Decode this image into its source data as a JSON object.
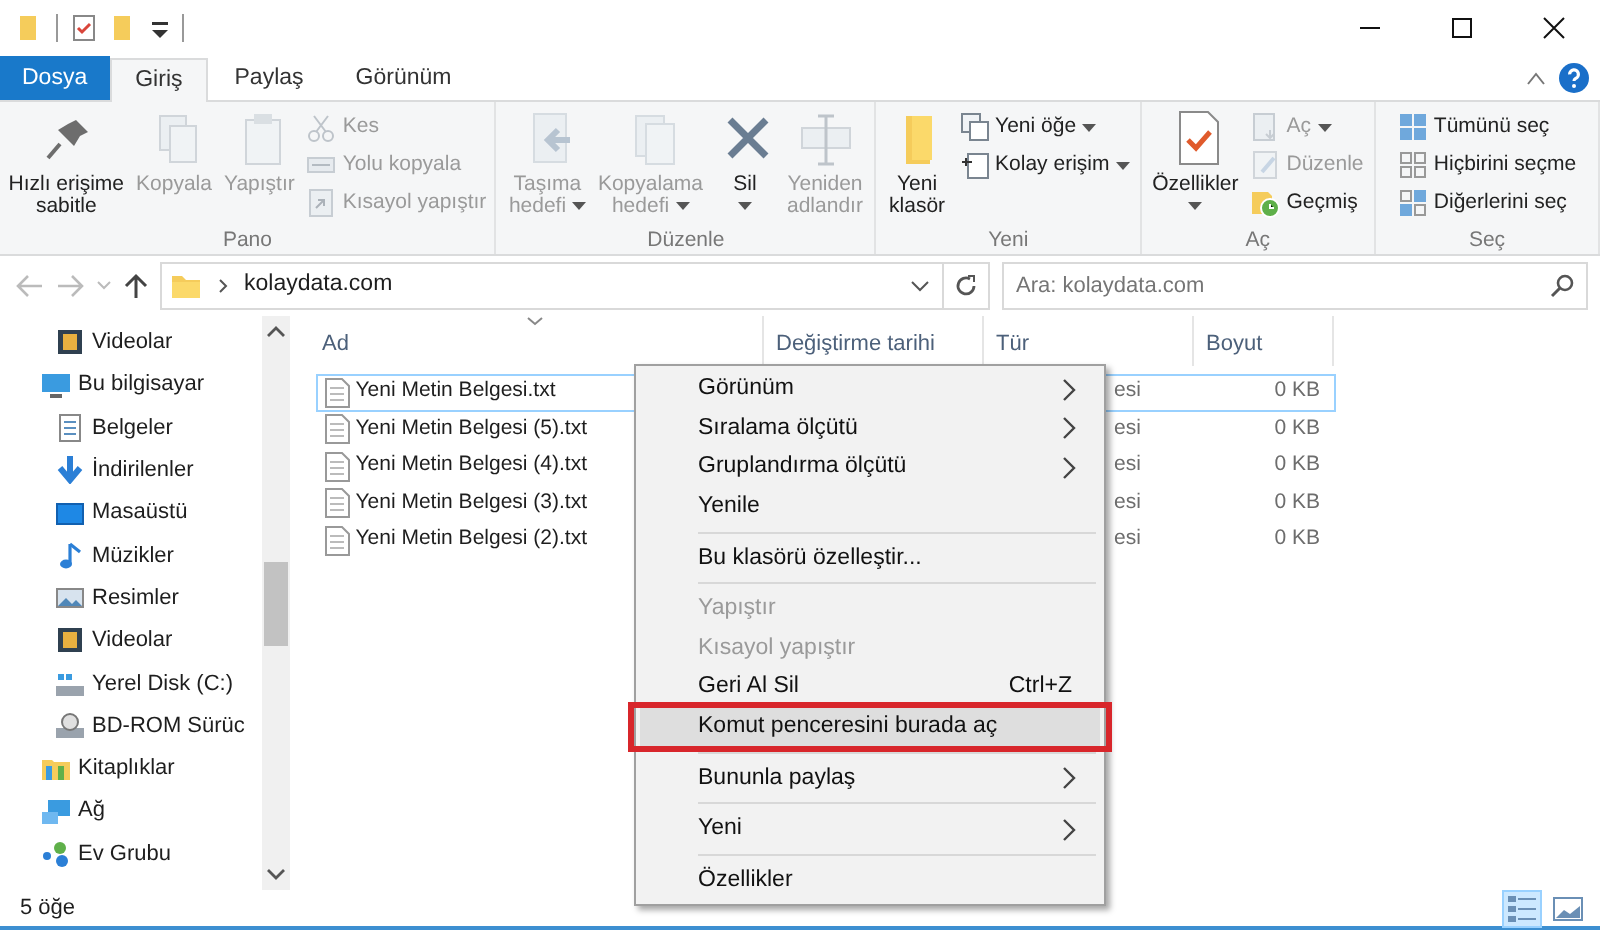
{
  "ribbon": {
    "tabs": [
      {
        "label": "Dosya",
        "kind": "file",
        "selected": false
      },
      {
        "label": "Giriş",
        "kind": "tab",
        "selected": true
      },
      {
        "label": "Paylaş",
        "kind": "tab",
        "selected": false
      },
      {
        "label": "Görünüm",
        "kind": "tab",
        "selected": false
      }
    ],
    "groups": [
      {
        "label": "Pano",
        "commands": [
          {
            "kind": "large",
            "lines": [
              "Hızlı erişime",
              "sabitle"
            ],
            "disabled": false
          },
          {
            "kind": "large",
            "lines": [
              "Kopyala"
            ],
            "disabled": true
          },
          {
            "kind": "large",
            "lines": [
              "Yapıştır"
            ],
            "disabled": true
          },
          {
            "kind": "small",
            "lines": [
              "Kes"
            ],
            "disabled": true
          },
          {
            "kind": "small",
            "lines": [
              "Yolu kopyala"
            ],
            "disabled": true
          },
          {
            "kind": "small",
            "lines": [
              "Kısayol yapıştır"
            ],
            "disabled": true
          }
        ]
      },
      {
        "label": "Düzenle",
        "commands": [
          {
            "kind": "large",
            "lines": [
              "Taşıma",
              "hedefi"
            ],
            "disabled": true,
            "dropdown": true
          },
          {
            "kind": "large",
            "lines": [
              "Kopyalama",
              "hedefi"
            ],
            "disabled": true,
            "dropdown": true
          },
          {
            "kind": "large",
            "lines": [
              "Sil"
            ],
            "disabled": false,
            "dropdown": true
          },
          {
            "kind": "large",
            "lines": [
              "Yeniden",
              "adlandır"
            ],
            "disabled": true
          }
        ]
      },
      {
        "label": "Yeni",
        "commands": [
          {
            "kind": "large",
            "lines": [
              "Yeni",
              "klasör"
            ],
            "disabled": false
          },
          {
            "kind": "small",
            "lines": [
              "Yeni öğe"
            ],
            "disabled": false,
            "dropdown": true
          },
          {
            "kind": "small",
            "lines": [
              "Kolay erişim"
            ],
            "disabled": false,
            "dropdown": true
          }
        ]
      },
      {
        "label": "Aç",
        "commands": [
          {
            "kind": "large",
            "lines": [
              "Özellikler"
            ],
            "disabled": false,
            "dropdown": true
          },
          {
            "kind": "small",
            "lines": [
              "Aç"
            ],
            "disabled": true,
            "dropdown": true
          },
          {
            "kind": "small",
            "lines": [
              "Düzenle"
            ],
            "disabled": true
          },
          {
            "kind": "small",
            "lines": [
              "Geçmiş"
            ],
            "disabled": false
          }
        ]
      },
      {
        "label": "Seç",
        "commands": [
          {
            "kind": "small",
            "lines": [
              "Tümünü seç"
            ],
            "disabled": false
          },
          {
            "kind": "small",
            "lines": [
              "Hiçbirini seçme"
            ],
            "disabled": false
          },
          {
            "kind": "small",
            "lines": [
              "Diğerlerini seç"
            ],
            "disabled": false
          }
        ]
      }
    ]
  },
  "address": {
    "path": [
      "kolaydata.com"
    ],
    "search": {
      "placeholder": "Ara: kolaydata.com"
    }
  },
  "navigation": [
    {
      "children": [
        {
          "label": "Videolar"
        }
      ]
    },
    {
      "label": "Bu bilgisayar",
      "children": [
        {
          "label": "Belgeler"
        },
        {
          "label": "İndirilenler"
        },
        {
          "label": "Masaüstü"
        },
        {
          "label": "Müzikler"
        },
        {
          "label": "Resimler"
        },
        {
          "label": "Videolar"
        },
        {
          "label": "Yerel Disk (C:)"
        },
        {
          "label": "BD-ROM Sürüc"
        }
      ]
    },
    {
      "label": "Kitaplıklar"
    },
    {
      "label": "Ağ"
    },
    {
      "label": "Ev Grubu"
    }
  ],
  "files": {
    "columns": [
      "Ad",
      "Değiştirme tarihi",
      "Tür",
      "Boyut"
    ],
    "rows": [
      {
        "name": "Yeni Metin Belgesi.txt",
        "type": "esi",
        "size": "0 KB",
        "selected": true
      },
      {
        "name": "Yeni Metin Belgesi (5).txt",
        "type": "esi",
        "size": "0 KB",
        "selected": false
      },
      {
        "name": "Yeni Metin Belgesi (4).txt",
        "type": "esi",
        "size": "0 KB",
        "selected": false
      },
      {
        "name": "Yeni Metin Belgesi (3).txt",
        "type": "esi",
        "size": "0 KB",
        "selected": false
      },
      {
        "name": "Yeni Metin Belgesi (2).txt",
        "type": "esi",
        "size": "0 KB",
        "selected": false
      }
    ]
  },
  "context_menu": {
    "sections": [
      [
        {
          "label": "Görünüm",
          "submenu": true
        },
        {
          "label": "Sıralama ölçütü",
          "submenu": true
        },
        {
          "label": "Gruplandırma ölçütü",
          "submenu": true
        },
        {
          "label": "Yenile"
        }
      ],
      [
        {
          "label": "Bu klasörü özelleştir..."
        }
      ],
      [
        {
          "label": "Yapıştır",
          "disabled": true
        },
        {
          "label": "Kısayol yapıştır",
          "disabled": true
        },
        {
          "label": "Geri Al Sil",
          "shortcut": "Ctrl+Z"
        },
        {
          "label": "Komut penceresini burada aç",
          "hovered": true,
          "outlined": true
        }
      ],
      [
        {
          "label": "Bununla paylaş",
          "submenu": true
        }
      ],
      [
        {
          "label": "Yeni",
          "submenu": true
        }
      ],
      [
        {
          "label": "Özellikler"
        }
      ]
    ]
  },
  "status_bar": {
    "item_count": "5 öğe",
    "view_buttons": [
      {
        "selected": true
      },
      {
        "selected": false
      }
    ]
  }
}
